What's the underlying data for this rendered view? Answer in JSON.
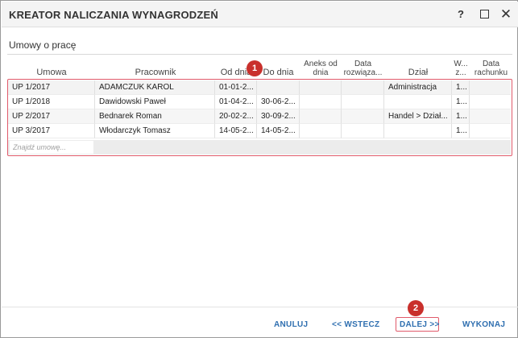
{
  "window": {
    "title": "KREATOR NALICZANIA WYNAGRODZEŃ",
    "help_label": "?",
    "close_label": "✕"
  },
  "section": {
    "title": "Umowy o pracę"
  },
  "columns": [
    "Umowa",
    "Pracownik",
    "Od dnia",
    "Do dnia",
    "Aneks od dnia",
    "Data rozwiąza...",
    "Dział",
    "W... z...",
    "Data rachunku"
  ],
  "rows": [
    [
      "UP 1/2017",
      "ADAMCZUK KAROL",
      "01-01-2...",
      "",
      "",
      "",
      "Administracja",
      "1...",
      ""
    ],
    [
      "UP 1/2018",
      "Dawidowski Paweł",
      "01-04-2...",
      "30-06-2...",
      "",
      "",
      "",
      "1...",
      ""
    ],
    [
      "UP 2/2017",
      "Bednarek Roman",
      "20-02-2...",
      "30-09-2...",
      "",
      "",
      "Handel > Dział...",
      "1...",
      ""
    ],
    [
      "UP 3/2017",
      "Włodarczyk Tomasz",
      "14-05-2...",
      "14-05-2...",
      "",
      "",
      "",
      "1...",
      ""
    ]
  ],
  "search": {
    "placeholder": "Znajdź umowę..."
  },
  "markers": {
    "first": "1",
    "second": "2"
  },
  "footer": {
    "cancel_label": "ANULUJ",
    "back_label": "<< WSTECZ",
    "next_label": "DALEJ >>",
    "execute_label": "WYKONAJ"
  },
  "colors": {
    "accent_link": "#2f6fb0",
    "highlight_border": "#e05a6a",
    "marker_fill": "#c9302c"
  }
}
